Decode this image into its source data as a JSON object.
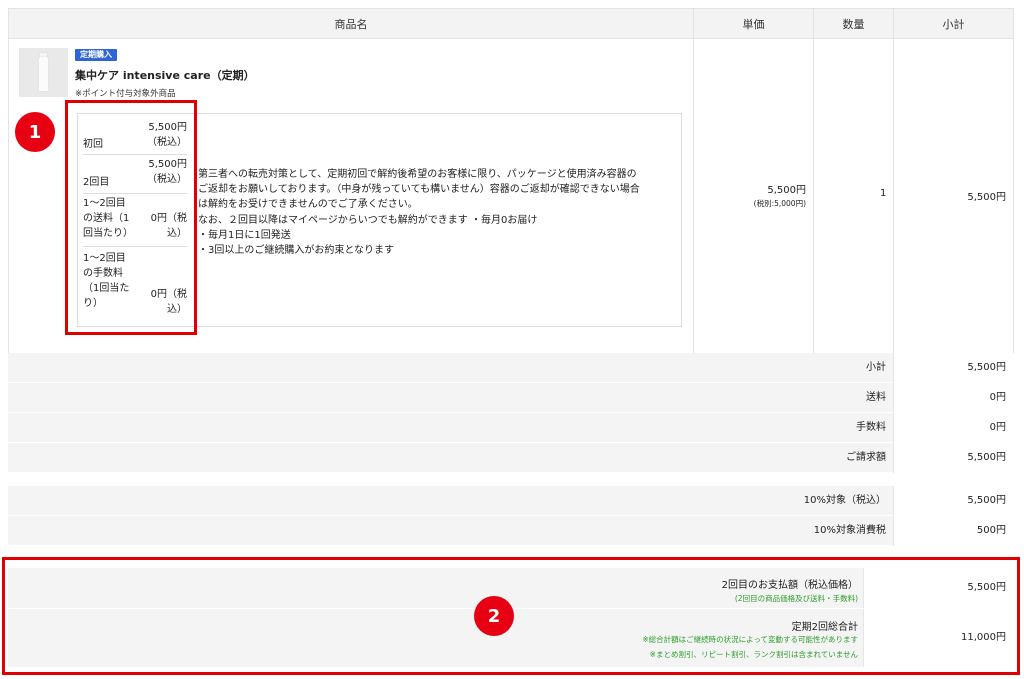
{
  "header": {
    "product_name": "商品名",
    "unit_price": "単価",
    "quantity": "数量",
    "subtotal": "小計"
  },
  "product": {
    "badge": "定期購入",
    "name": "集中ケア intensive care（定期）",
    "point_note": "※ポイント付与対象外商品",
    "schedule": [
      {
        "label_lines": [
          "初回"
        ],
        "value_lines": [
          "5,500円",
          "（税込）"
        ]
      },
      {
        "label_lines": [
          "2回目"
        ],
        "value_lines": [
          "5,500円",
          "（税込）"
        ]
      },
      {
        "label_lines": [
          "1～2回目",
          "の送料（1",
          "回当たり）"
        ],
        "value_lines": [
          "0円（税",
          "込）"
        ]
      },
      {
        "label_lines": [
          "1～2回目",
          "の手数料",
          "（1回当た",
          "り）"
        ],
        "value_lines": [
          "0円（税",
          "込）"
        ]
      }
    ],
    "description_lines": [
      "第三者への転売対策として、定期初回で解約後希望のお客様に限り、パッケージと使用済み容器の",
      "ご返却をお願いしております。（中身が残っていても構いません）容器のご返却が確認できない場合",
      "は解約をお受けできませんのでご了承ください。",
      "なお、２回目以降はマイページからいつでも解約ができます ・毎月0お届け",
      "・毎月1日に1回発送",
      "・3回以上のご継続購入がお約束となります"
    ],
    "unit_price": "5,500円",
    "unit_price_ex_tax": "(税別:5,000円)",
    "quantity": "1",
    "subtotal": "5,500円"
  },
  "summary": [
    {
      "label": "小計",
      "value": "5,500円"
    },
    {
      "label": "送料",
      "value": "0円"
    },
    {
      "label": "手数料",
      "value": "0円"
    },
    {
      "label": "ご請求額",
      "value": "5,500円"
    }
  ],
  "tax": [
    {
      "label": "10%対象（税込）",
      "value": "5,500円"
    },
    {
      "label": "10%対象消費税",
      "value": "500円"
    }
  ],
  "second_payment": {
    "label": "2回目のお支払額（税込価格）",
    "note": "(2回目の商品価格及び送料・手数料)",
    "value": "5,500円"
  },
  "total_2": {
    "label": "定期2回総合計",
    "notes": [
      "※総合計額はご継続時の状況によって変動する可能性があります",
      "※まとめ割引、リピート割引、ランク割引は含まれていません"
    ],
    "value": "11,000円"
  },
  "annotations": {
    "one": "1",
    "two": "2"
  },
  "colors": {
    "highlight": "#e00000",
    "badge": "#2f64d6",
    "note_green": "#2a9d2a"
  }
}
